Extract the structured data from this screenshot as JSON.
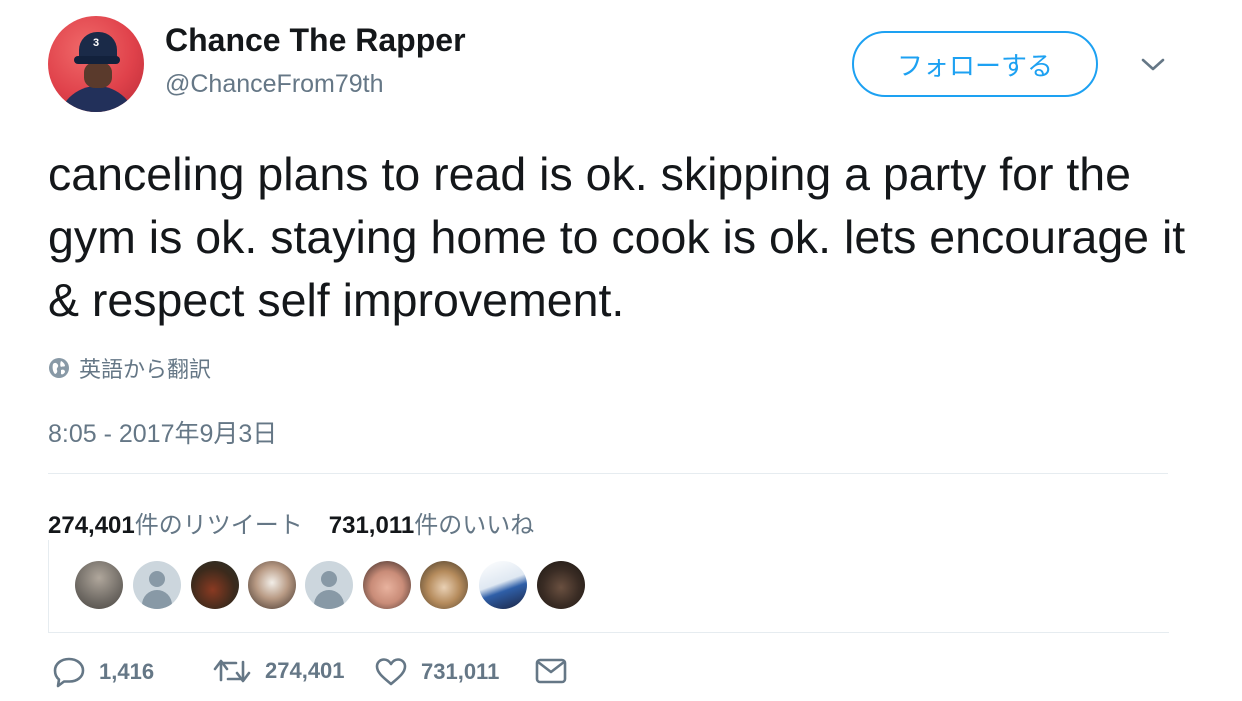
{
  "user": {
    "display_name": "Chance The Rapper",
    "handle": "@ChanceFrom79th",
    "avatar_cap_text": "3"
  },
  "follow_button_label": "フォローする",
  "tweet": {
    "text": "canceling plans to read is ok. skipping a party for the gym is ok. staying home to cook is ok. lets encourage it & respect self improvement.",
    "translate_label": "英語から翻訳",
    "timestamp": "8:05 - 2017年9月3日"
  },
  "stats": {
    "retweet_count": "274,401",
    "retweet_label": "件のリツイート",
    "like_count": "731,011",
    "like_label": "件のいいね"
  },
  "actions": {
    "reply_count": "1,416",
    "retweet_count": "274,401",
    "like_count": "731,011"
  },
  "colors": {
    "accent": "#1da1f2",
    "secondary_text": "#657786",
    "primary_text": "#14171a",
    "divider": "#e6ecf0"
  },
  "icons": [
    "globe-icon",
    "chevron-down-icon",
    "reply-icon",
    "retweet-icon",
    "heart-icon",
    "envelope-icon"
  ]
}
